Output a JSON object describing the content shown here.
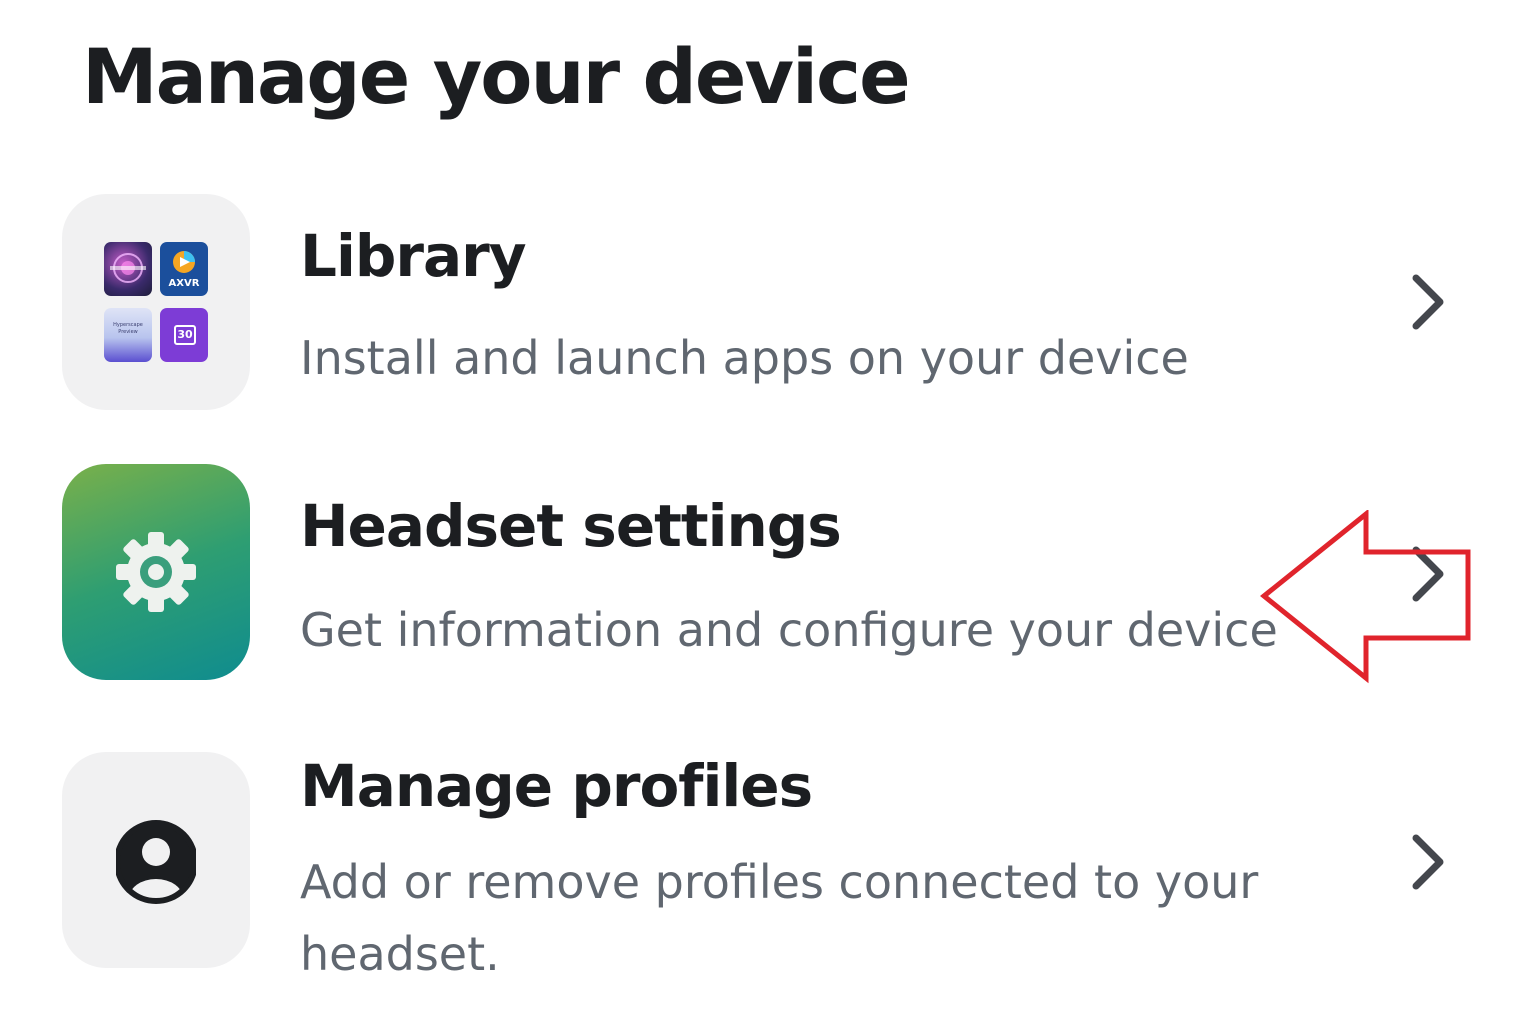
{
  "header": {
    "title": "Manage your device"
  },
  "items": [
    {
      "id": "library",
      "title": "Library",
      "description": "Install and launch apps on your device",
      "icon": "app-grid-icon",
      "apps": [
        {
          "label": ""
        },
        {
          "label": "AXVR"
        },
        {
          "label": "Hyperscape Preview"
        },
        {
          "label": "30"
        }
      ]
    },
    {
      "id": "headset-settings",
      "title": "Headset settings",
      "description": "Get information and configure your device",
      "icon": "gear-icon"
    },
    {
      "id": "manage-profiles",
      "title": "Manage profiles",
      "description": "Add or remove profiles connected to your headset.",
      "icon": "person-icon"
    }
  ],
  "colors": {
    "title_text": "#1c1e21",
    "description_text": "#606770",
    "tile_background": "#f1f1f2",
    "settings_gradient_start": "#7ab04a",
    "settings_gradient_end": "#0f8c8f",
    "annotation_arrow": "#e0242c"
  },
  "annotation": {
    "type": "arrow",
    "direction": "left",
    "target": "headset-settings-chevron"
  }
}
